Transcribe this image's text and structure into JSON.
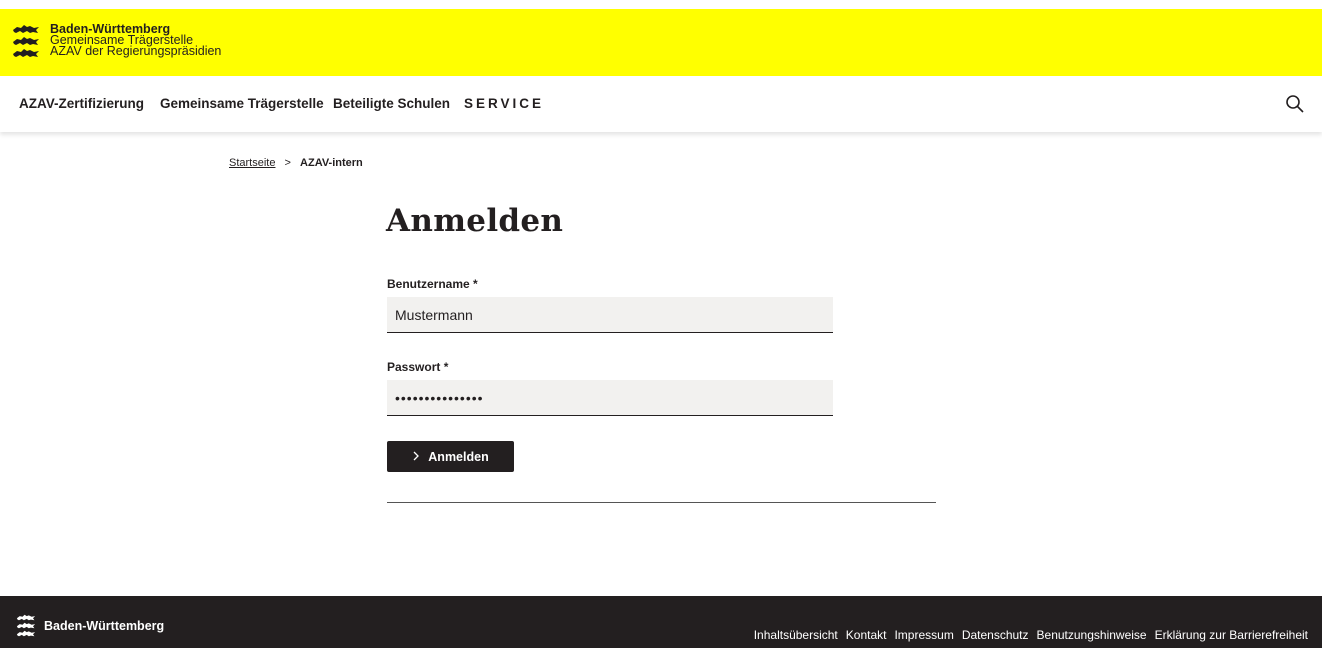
{
  "header": {
    "logo_title": "Baden-Württemberg",
    "logo_line2": "Gemeinsame Trägerstelle",
    "logo_line3": "AZAV der Regierungspräsidien"
  },
  "nav": {
    "items": [
      "AZAV-Zertifizierung",
      "Gemeinsame Trägerstelle",
      "Beteiligte Schulen",
      "SERVICE"
    ],
    "search_icon": "search-icon"
  },
  "breadcrumb": {
    "home": "Startseite",
    "separator": ">",
    "current": "AZAV-intern"
  },
  "page": {
    "title": "Anmelden"
  },
  "form": {
    "username_label": "Benutzername *",
    "username_value": "Mustermann",
    "password_label": "Passwort *",
    "password_value": "•••••••••••••••",
    "submit_label": "Anmelden",
    "submit_icon": "chevron-right-icon"
  },
  "footer": {
    "title": "Baden-Württemberg",
    "links": [
      "Inhaltsübersicht",
      "Kontakt",
      "Impressum",
      "Datenschutz",
      "Benutzungshinweise",
      "Erklärung zur Barrierefreiheit"
    ]
  },
  "colors": {
    "header_bg": "#ffff00",
    "dark": "#231f20",
    "field_bg": "#f2f1ef"
  }
}
